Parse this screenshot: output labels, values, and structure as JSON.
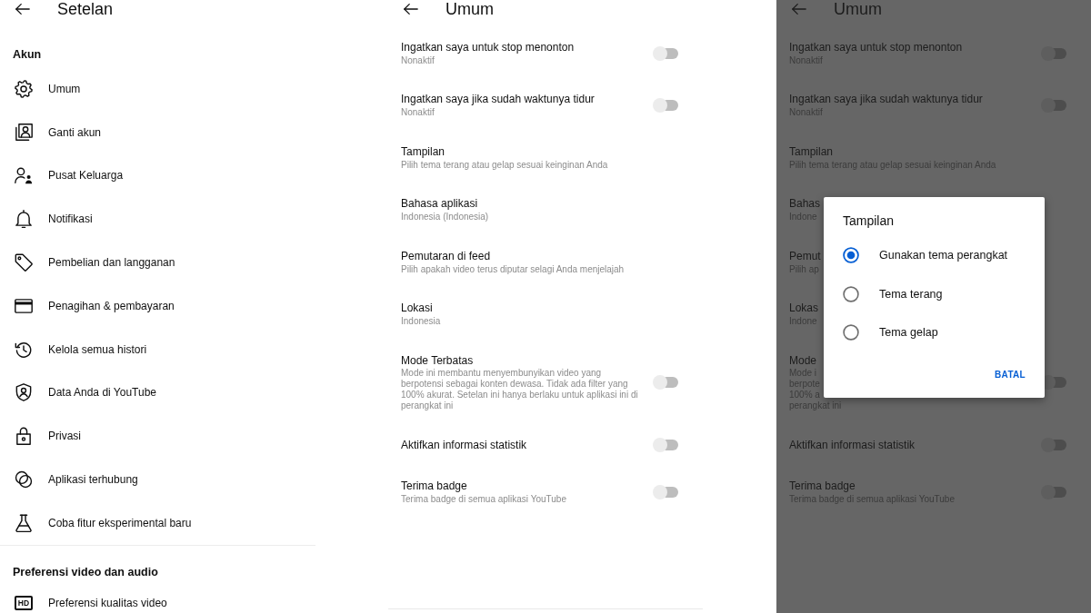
{
  "settings_screen": {
    "title": "Setelan",
    "sections": [
      {
        "heading": "Akun",
        "items": [
          {
            "label": "Umum"
          },
          {
            "label": "Ganti akun"
          },
          {
            "label": "Pusat Keluarga"
          },
          {
            "label": "Notifikasi"
          },
          {
            "label": "Pembelian dan langganan"
          },
          {
            "label": "Penagihan & pembayaran"
          },
          {
            "label": "Kelola semua histori"
          },
          {
            "label": "Data Anda di YouTube"
          },
          {
            "label": "Privasi"
          },
          {
            "label": "Aplikasi terhubung"
          },
          {
            "label": "Coba fitur eksperimental baru"
          }
        ]
      },
      {
        "heading": "Preferensi video dan audio",
        "items": [
          {
            "label": "Preferensi kualitas video",
            "badge": "HD"
          }
        ]
      }
    ]
  },
  "general_screen": {
    "title": "Umum",
    "items": [
      {
        "kind": "toggle",
        "title": "Ingatkan saya untuk stop menonton",
        "subtitle": "Nonaktif",
        "on": false
      },
      {
        "kind": "toggle",
        "title": "Ingatkan saya jika sudah waktunya tidur",
        "subtitle": "Nonaktif",
        "on": false
      },
      {
        "kind": "link",
        "title": "Tampilan",
        "subtitle": "Pilih tema terang atau gelap sesuai keinginan Anda"
      },
      {
        "kind": "link",
        "title": "Bahasa aplikasi",
        "subtitle": "Indonesia (Indonesia)"
      },
      {
        "kind": "link",
        "title": "Pemutaran di feed",
        "subtitle": "Pilih apakah video terus diputar selagi Anda menjelajah"
      },
      {
        "kind": "link",
        "title": "Lokasi",
        "subtitle": "Indonesia"
      },
      {
        "kind": "toggle",
        "title": "Mode Terbatas",
        "description": "Mode ini membantu menyembunyikan video yang berpotensi sebagai konten dewasa. Tidak ada filter yang 100% akurat. Setelan ini hanya berlaku untuk aplikasi ini di perangkat ini",
        "on": false
      },
      {
        "kind": "toggle",
        "title": "Aktifkan informasi statistik",
        "on": false
      },
      {
        "kind": "toggle",
        "title": "Terima badge",
        "subtitle": "Terima badge di semua aplikasi YouTube",
        "on": false
      }
    ]
  },
  "dimmed_general_screen": {
    "dimmed": true,
    "title": "Umum",
    "items": [
      {
        "kind": "toggle",
        "title": "Ingatkan saya untuk stop menonton",
        "subtitle": "Nonaktif",
        "on": false
      },
      {
        "kind": "toggle",
        "title": "Ingatkan saya jika sudah waktunya tidur",
        "subtitle": "Nonaktif",
        "on": false
      },
      {
        "kind": "link",
        "title": "Tampilan",
        "subtitle": "Pilih tema terang atau gelap sesuai keinginan Anda"
      },
      {
        "kind": "link",
        "title": "Bahas",
        "subtitle": "Indone"
      },
      {
        "kind": "link",
        "title": "Pemut",
        "subtitle": "Pilih ap"
      },
      {
        "kind": "link",
        "title": "Lokas",
        "subtitle": "Indone"
      },
      {
        "kind": "toggle",
        "title": "Mode",
        "subtitle_lines": [
          "Mode i",
          "berpote",
          "100% a",
          "perangkat ini"
        ],
        "on": false
      },
      {
        "kind": "toggle",
        "title": "Aktifkan informasi statistik",
        "on": false
      },
      {
        "kind": "toggle",
        "title": "Terima badge",
        "subtitle": "Terima badge di semua aplikasi YouTube",
        "on": false
      }
    ]
  },
  "theme_dialog": {
    "title": "Tampilan",
    "options": [
      {
        "label": "Gunakan tema perangkat",
        "selected": true
      },
      {
        "label": "Tema terang",
        "selected": false
      },
      {
        "label": "Tema gelap",
        "selected": false
      }
    ],
    "buttons": [
      "BATAL"
    ]
  }
}
